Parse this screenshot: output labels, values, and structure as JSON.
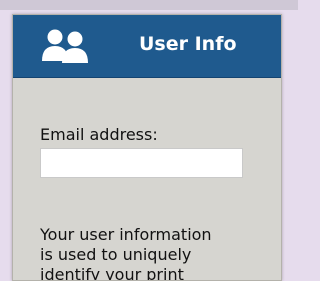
{
  "panel": {
    "title": "User Info",
    "icon": "users-icon",
    "header_color": "#1f5a8e",
    "background_color": "#d6d5d0"
  },
  "email": {
    "label": "Email address:",
    "value": "",
    "placeholder": ""
  },
  "info": {
    "lines": [
      "Your user information",
      "is used to uniquely",
      "identify your print"
    ]
  }
}
